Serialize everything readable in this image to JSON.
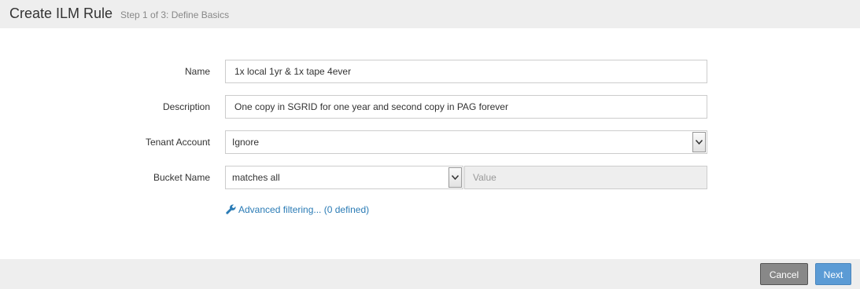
{
  "header": {
    "title": "Create ILM Rule",
    "subtitle": "Step 1 of 3: Define Basics"
  },
  "form": {
    "name": {
      "label": "Name",
      "value": "1x local 1yr & 1x tape 4ever"
    },
    "description": {
      "label": "Description",
      "value": "One copy in SGRID for one year and second copy in PAG forever"
    },
    "tenant_account": {
      "label": "Tenant Account",
      "selected": "Ignore"
    },
    "bucket_name": {
      "label": "Bucket Name",
      "selected": "matches all",
      "value_placeholder": "Value"
    }
  },
  "advanced_filtering": {
    "label": "Advanced filtering...",
    "count": "(0 defined)",
    "icon": "wrench-icon"
  },
  "footer": {
    "cancel_label": "Cancel",
    "next_label": "Next"
  },
  "colors": {
    "header_bg": "#eeeeee",
    "link": "#2a7bb5",
    "cancel_button": "#888888",
    "next_button": "#5b9bd5"
  }
}
